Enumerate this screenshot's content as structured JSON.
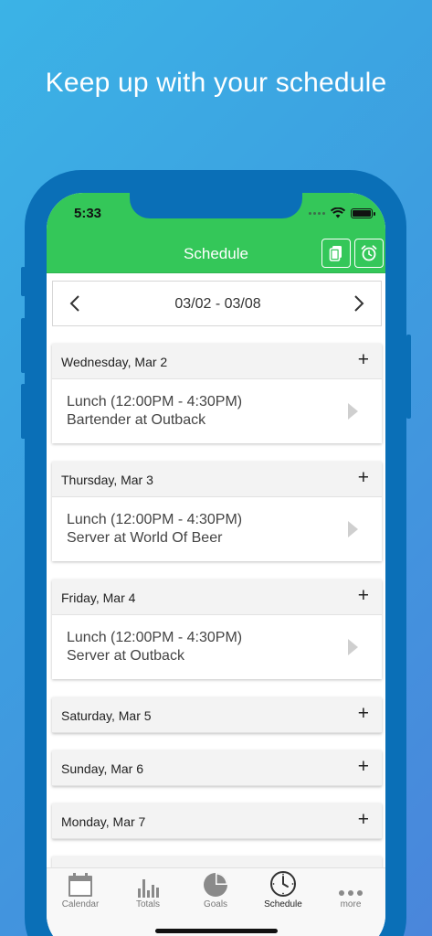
{
  "headline": "Keep up with your schedule",
  "status_bar": {
    "time": "5:33"
  },
  "nav": {
    "title": "Schedule",
    "buttons": [
      "copy-icon",
      "alarm-icon"
    ]
  },
  "week_selector": {
    "range": "03/02 - 03/08"
  },
  "days": [
    {
      "title": "Wednesday, Mar 2",
      "shift": {
        "time": "Lunch (12:00PM - 4:30PM)",
        "role": "Bartender at Outback"
      }
    },
    {
      "title": "Thursday, Mar 3",
      "shift": {
        "time": "Lunch (12:00PM - 4:30PM)",
        "role": "Server at World Of Beer"
      }
    },
    {
      "title": "Friday, Mar 4",
      "shift": {
        "time": "Lunch (12:00PM - 4:30PM)",
        "role": "Server at Outback"
      }
    },
    {
      "title": "Saturday, Mar 5"
    },
    {
      "title": "Sunday, Mar 6"
    },
    {
      "title": "Monday, Mar 7"
    }
  ],
  "add_symbol": "+",
  "tabs": [
    {
      "label": "Calendar",
      "icon": "calendar-icon"
    },
    {
      "label": "Totals",
      "icon": "bar-chart-icon"
    },
    {
      "label": "Goals",
      "icon": "pie-chart-icon"
    },
    {
      "label": "Schedule",
      "icon": "clock-icon",
      "active": true
    },
    {
      "label": "more",
      "icon": "more-dots-icon"
    }
  ],
  "colors": {
    "accent": "#34c759",
    "frame": "#0a6fb7",
    "background_start": "#3bb3e6",
    "background_end": "#4a86db"
  }
}
